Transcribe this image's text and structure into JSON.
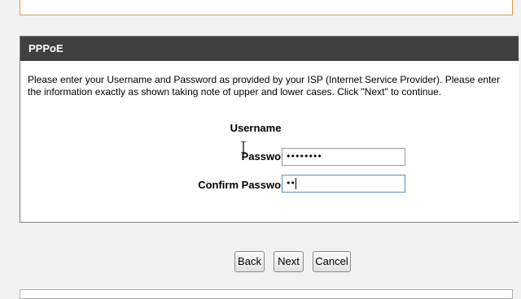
{
  "panel": {
    "title": "PPPoE",
    "instructions": "Please enter your Username and Password as provided by your ISP (Internet Service Provider). Please enter the information exactly as shown taking note of upper and lower cases. Click \"Next\" to continue."
  },
  "form": {
    "username_label": "Username",
    "password_label": "Password :",
    "password_value": "••••••••",
    "confirm_label": "Confirm Password :",
    "confirm_value": "••"
  },
  "buttons": {
    "back": "Back",
    "next": "Next",
    "cancel": "Cancel"
  },
  "colors": {
    "header_bg": "#404040",
    "top_border": "#e09a4a",
    "active_field_border": "#5b8cc6"
  }
}
